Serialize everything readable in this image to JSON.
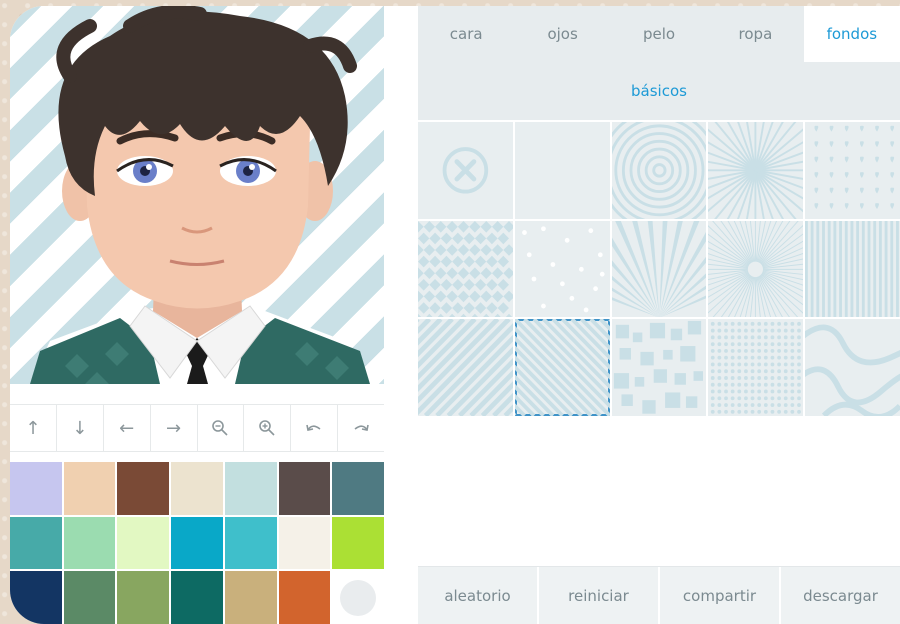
{
  "tabs": [
    {
      "label": "cara"
    },
    {
      "label": "ojos"
    },
    {
      "label": "pelo"
    },
    {
      "label": "ropa"
    },
    {
      "label": "fondos",
      "active": true
    }
  ],
  "subheader": {
    "label": "básicos"
  },
  "toolbar": [
    {
      "icon": "arrow-up-icon",
      "glyph": "↑"
    },
    {
      "icon": "arrow-down-icon",
      "glyph": "↓"
    },
    {
      "icon": "arrow-left-icon",
      "glyph": "←"
    },
    {
      "icon": "arrow-right-icon",
      "glyph": "→"
    },
    {
      "icon": "zoom-out-icon"
    },
    {
      "icon": "zoom-in-icon"
    },
    {
      "icon": "undo-icon"
    },
    {
      "icon": "redo-icon"
    }
  ],
  "palette": [
    "#c6c6ef",
    "#f0d0b0",
    "#7a4a36",
    "#ece3cf",
    "#c2dfdf",
    "#5a4c4a",
    "#4f7a82",
    "#47aaa8",
    "#9bdcb0",
    "#e2f8c2",
    "#09a8c8",
    "#3fbfcb",
    "#f5f1e8",
    "#abe034",
    "#133563",
    "#5b8a66",
    "#88a660",
    "#0d6a63",
    "#c9b07c",
    "#d2642d",
    "empty"
  ],
  "backgrounds": {
    "patterns": [
      "none-icon",
      "plain",
      "concentric-circles",
      "sunburst",
      "hearts",
      "diamonds",
      "dots-scattered",
      "rays",
      "starburst",
      "vertical-stripes",
      "diagonal-stripes",
      "diagonal-stripes-thin",
      "squares",
      "dot-grid",
      "waves"
    ],
    "selected_index": 11
  },
  "actions": [
    {
      "label": "aleatorio"
    },
    {
      "label": "reiniciar"
    },
    {
      "label": "compartir"
    },
    {
      "label": "descargar"
    }
  ],
  "colors": {
    "accent": "#1d9ad6",
    "tab_bg": "#e7ecee",
    "pattern": "#c9dfe6"
  }
}
